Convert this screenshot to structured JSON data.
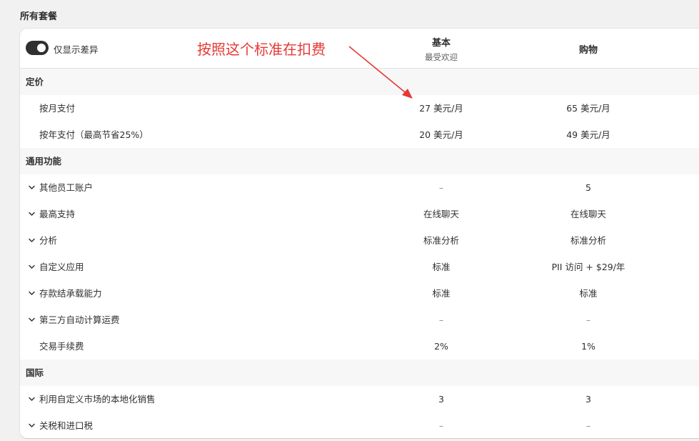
{
  "section_title": "所有套餐",
  "toggle": {
    "label": "仅显示差异",
    "on": true
  },
  "plans": [
    {
      "name": "基本",
      "subtitle": "最受欢迎"
    },
    {
      "name": "购物",
      "subtitle": ""
    }
  ],
  "annotation": {
    "text": "按照这个标准在扣费",
    "color": "#e53935"
  },
  "rows": [
    {
      "type": "group",
      "label": "定价"
    },
    {
      "type": "item",
      "label": "按月支付",
      "basic": "27 美元/月",
      "shop": "65 美元/月",
      "expandable": false
    },
    {
      "type": "item",
      "label": "按年支付（最高节省25%）",
      "basic": "20 美元/月",
      "shop": "49 美元/月",
      "expandable": false
    },
    {
      "type": "group",
      "label": "通用功能"
    },
    {
      "type": "item",
      "label": "其他员工账户",
      "basic": "–",
      "shop": "5",
      "expandable": true
    },
    {
      "type": "item",
      "label": "最高支持",
      "basic": "在线聊天",
      "shop": "在线聊天",
      "expandable": true
    },
    {
      "type": "item",
      "label": "分析",
      "basic": "标准分析",
      "shop": "标准分析",
      "expandable": true
    },
    {
      "type": "item",
      "label": "自定义应用",
      "basic": "标准",
      "shop": "PII 访问 + $29/年",
      "expandable": true
    },
    {
      "type": "item",
      "label": "存款结承载能力",
      "basic": "标准",
      "shop": "标准",
      "expandable": true
    },
    {
      "type": "item",
      "label": "第三方自动计算运费",
      "basic": "–",
      "shop": "–",
      "expandable": true
    },
    {
      "type": "item",
      "label": "交易手续费",
      "basic": "2%",
      "shop": "1%",
      "expandable": false
    },
    {
      "type": "group",
      "label": "国际"
    },
    {
      "type": "item",
      "label": "利用自定义市场的本地化销售",
      "basic": "3",
      "shop": "3",
      "expandable": true
    },
    {
      "type": "item",
      "label": "关税和进口税",
      "basic": "–",
      "shop": "–",
      "expandable": true
    }
  ]
}
